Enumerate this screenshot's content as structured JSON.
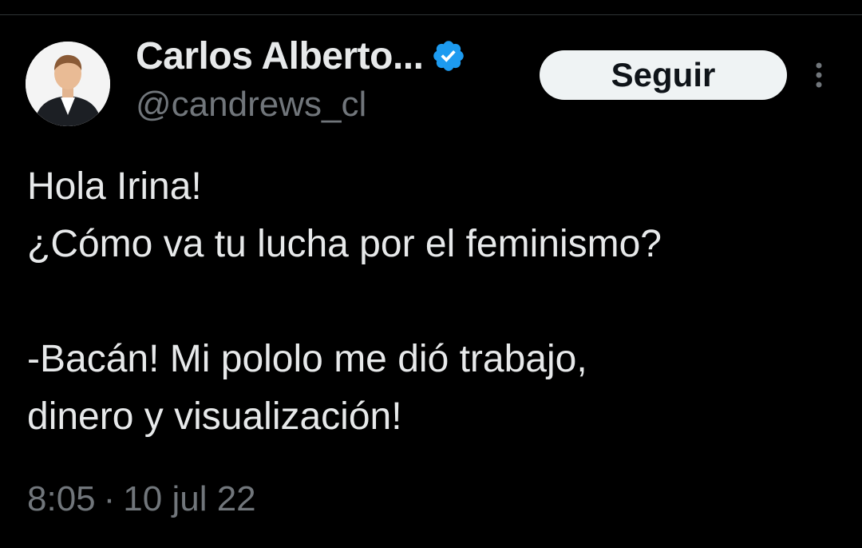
{
  "author": {
    "display_name": "Carlos Alberto...",
    "handle": "@candrews_cl",
    "verified_icon": "verified-badge-icon",
    "avatar_icon": "avatar"
  },
  "follow_button": {
    "label": "Seguir"
  },
  "more_menu": {
    "icon": "more-vertical-icon"
  },
  "tweet": {
    "lines": [
      "Hola Irina!",
      "¿Cómo va tu lucha por el feminismo?",
      "",
      "-Bacán! Mi pololo me dió trabajo,",
      "dinero y visualización!"
    ]
  },
  "meta": {
    "time": "8:05",
    "separator": "·",
    "date": "10 jul 22"
  },
  "colors": {
    "background": "#000000",
    "text_primary": "#e7e9ea",
    "text_secondary": "#71767b",
    "verified_blue": "#1d9bf0",
    "button_bg": "#eff3f4"
  }
}
